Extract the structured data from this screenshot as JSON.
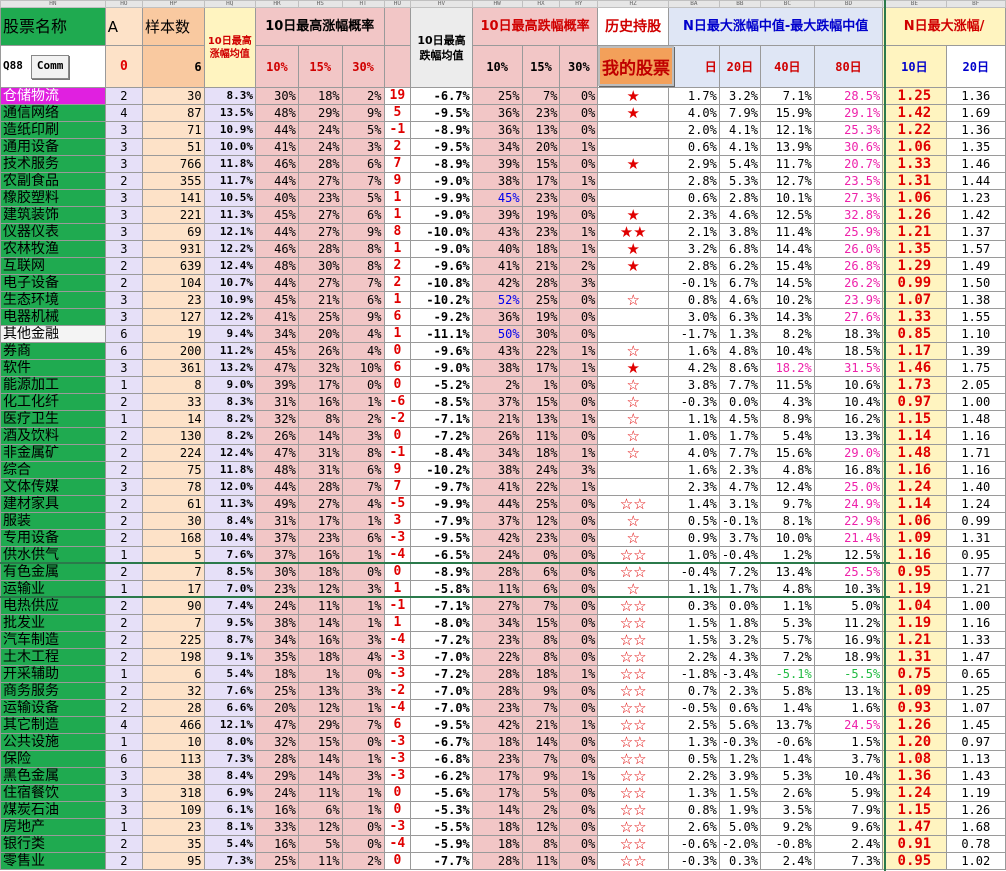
{
  "colors": {
    "green": "#1faa50",
    "pink": "#f2c6c6",
    "blue_head": "#dfe6f5",
    "orange": "#f9c9a0",
    "yellow": "#fff4c0",
    "red": "#e00000",
    "lav": "#e6e0f8",
    "peach": "#fde2c8"
  },
  "col_letters": [
    "HN",
    "HO",
    "HP",
    "HQ",
    "HR",
    "HS",
    "HT",
    "HU",
    "HV",
    "HW",
    "HX",
    "HY",
    "HZ",
    "BA",
    "BB",
    "BC",
    "BD",
    "BE",
    "BF"
  ],
  "header1": {
    "name": "股票名称",
    "a": "A",
    "count": "样本数",
    "avg10": "10日最高涨幅均值",
    "up10": "10日最高涨幅概率",
    "down_avg": "10日最高跌幅均值",
    "down10": "10日最高跌幅概率",
    "history": "历史持股",
    "median": "N日最大涨幅中值-最大跌幅中值",
    "nmax": "N日最大涨幅/"
  },
  "header2": {
    "code": "Q88",
    "comm": "Comm",
    "a_val": "0",
    "count_val": "6",
    "p10": "10%",
    "p15": "15%",
    "p30": "30%",
    "d10": "10%",
    "d15": "15%",
    "d30": "30%",
    "day": "日",
    "d20": "20日",
    "d40": "40日",
    "d80": "80日",
    "n10": "10日",
    "n20": "20日"
  },
  "my_stock_button": "我的股票",
  "rows": [
    {
      "name": "仓储物流",
      "a": "2",
      "n": "30",
      "avg": "8.3%",
      "u10": "30%",
      "u15": "18%",
      "u30": "2%",
      "hu": "19",
      "hv": "-6.7%",
      "w10": "25%",
      "w15": "7%",
      "w30": "0%",
      "star": "★",
      "ba": "1.7%",
      "bb": "3.2%",
      "bc": "7.1%",
      "bd": "28.5%",
      "be": "1.25",
      "bf": "1.36",
      "nameBg": "#e020e0",
      "nameColor": "#ffffff",
      "bdRed": true
    },
    {
      "name": "通信网络",
      "a": "4",
      "n": "87",
      "avg": "13.5%",
      "u10": "48%",
      "u15": "29%",
      "u30": "9%",
      "hu": "5",
      "hv": "-9.5%",
      "w10": "36%",
      "w15": "23%",
      "w30": "0%",
      "star": "★",
      "ba": "4.0%",
      "bb": "7.9%",
      "bc": "15.9%",
      "bd": "29.1%",
      "be": "1.42",
      "bf": "1.69",
      "bdRed": true
    },
    {
      "name": "造纸印刷",
      "a": "3",
      "n": "71",
      "avg": "10.9%",
      "u10": "44%",
      "u15": "24%",
      "u30": "5%",
      "hu": "-1",
      "hv": "-8.9%",
      "w10": "36%",
      "w15": "13%",
      "w30": "0%",
      "star": "",
      "ba": "2.0%",
      "bb": "4.1%",
      "bc": "12.1%",
      "bd": "25.3%",
      "be": "1.22",
      "bf": "1.36",
      "bdRed": true
    },
    {
      "name": "通用设备",
      "a": "3",
      "n": "51",
      "avg": "10.0%",
      "u10": "41%",
      "u15": "24%",
      "u30": "3%",
      "hu": "2",
      "hv": "-9.5%",
      "w10": "34%",
      "w15": "20%",
      "w30": "1%",
      "star": "",
      "ba": "0.6%",
      "bb": "4.1%",
      "bc": "13.9%",
      "bd": "30.6%",
      "be": "1.06",
      "bf": "1.35",
      "bdRed": true
    },
    {
      "name": "技术服务",
      "a": "3",
      "n": "766",
      "avg": "11.8%",
      "u10": "46%",
      "u15": "28%",
      "u30": "6%",
      "hu": "7",
      "hv": "-8.9%",
      "w10": "39%",
      "w15": "15%",
      "w30": "0%",
      "star": "★",
      "ba": "2.9%",
      "bb": "5.4%",
      "bc": "11.7%",
      "bd": "20.7%",
      "be": "1.33",
      "bf": "1.46",
      "bdRed": true
    },
    {
      "name": "农副食品",
      "a": "2",
      "n": "355",
      "avg": "11.7%",
      "u10": "44%",
      "u15": "27%",
      "u30": "7%",
      "hu": "9",
      "hv": "-9.0%",
      "w10": "38%",
      "w15": "17%",
      "w30": "1%",
      "star": "",
      "ba": "2.8%",
      "bb": "5.3%",
      "bc": "12.7%",
      "bd": "23.5%",
      "be": "1.31",
      "bf": "1.44",
      "bdRed": true
    },
    {
      "name": "橡胶塑料",
      "a": "3",
      "n": "141",
      "avg": "10.5%",
      "u10": "40%",
      "u15": "23%",
      "u30": "5%",
      "hu": "1",
      "hv": "-9.9%",
      "w10": "45%",
      "w15": "23%",
      "w30": "0%",
      "star": "",
      "ba": "0.6%",
      "bb": "2.8%",
      "bc": "10.1%",
      "bd": "27.3%",
      "be": "1.06",
      "bf": "1.23",
      "bdRed": true,
      "w10Blue": true
    },
    {
      "name": "建筑装饰",
      "a": "3",
      "n": "221",
      "avg": "11.3%",
      "u10": "45%",
      "u15": "27%",
      "u30": "6%",
      "hu": "1",
      "hv": "-9.0%",
      "w10": "39%",
      "w15": "19%",
      "w30": "0%",
      "star": "★",
      "ba": "2.3%",
      "bb": "4.6%",
      "bc": "12.5%",
      "bd": "32.8%",
      "be": "1.26",
      "bf": "1.42",
      "bdRed": true
    },
    {
      "name": "仪器仪表",
      "a": "3",
      "n": "69",
      "avg": "12.1%",
      "u10": "44%",
      "u15": "27%",
      "u30": "9%",
      "hu": "8",
      "hv": "-10.0%",
      "w10": "43%",
      "w15": "23%",
      "w30": "1%",
      "star": "★★",
      "ba": "2.1%",
      "bb": "3.8%",
      "bc": "11.4%",
      "bd": "25.9%",
      "be": "1.21",
      "bf": "1.37",
      "bdRed": true
    },
    {
      "name": "农林牧渔",
      "a": "3",
      "n": "931",
      "avg": "12.2%",
      "u10": "46%",
      "u15": "28%",
      "u30": "8%",
      "hu": "1",
      "hv": "-9.0%",
      "w10": "40%",
      "w15": "18%",
      "w30": "1%",
      "star": "★",
      "ba": "3.2%",
      "bb": "6.8%",
      "bc": "14.4%",
      "bd": "26.0%",
      "be": "1.35",
      "bf": "1.57",
      "bdRed": true
    },
    {
      "name": "互联网",
      "a": "2",
      "n": "639",
      "avg": "12.4%",
      "u10": "48%",
      "u15": "30%",
      "u30": "8%",
      "hu": "2",
      "hv": "-9.6%",
      "w10": "41%",
      "w15": "21%",
      "w30": "2%",
      "star": "★",
      "ba": "2.8%",
      "bb": "6.2%",
      "bc": "15.4%",
      "bd": "26.8%",
      "be": "1.29",
      "bf": "1.49",
      "bdRed": true
    },
    {
      "name": "电子设备",
      "a": "2",
      "n": "104",
      "avg": "10.7%",
      "u10": "44%",
      "u15": "27%",
      "u30": "7%",
      "hu": "2",
      "hv": "-10.8%",
      "w10": "42%",
      "w15": "28%",
      "w30": "3%",
      "star": "",
      "ba": "-0.1%",
      "bb": "6.7%",
      "bc": "14.5%",
      "bd": "26.2%",
      "be": "0.99",
      "bf": "1.50",
      "bdRed": true
    },
    {
      "name": "生态环境",
      "a": "3",
      "n": "23",
      "avg": "10.9%",
      "u10": "45%",
      "u15": "21%",
      "u30": "6%",
      "hu": "1",
      "hv": "-10.2%",
      "w10": "52%",
      "w15": "25%",
      "w30": "0%",
      "star": "☆",
      "ba": "0.8%",
      "bb": "4.6%",
      "bc": "10.2%",
      "bd": "23.9%",
      "be": "1.07",
      "bf": "1.38",
      "bdRed": true,
      "w10Blue": true
    },
    {
      "name": "电器机械",
      "a": "3",
      "n": "127",
      "avg": "12.2%",
      "u10": "41%",
      "u15": "25%",
      "u30": "9%",
      "hu": "6",
      "hv": "-9.2%",
      "w10": "36%",
      "w15": "19%",
      "w30": "0%",
      "star": "",
      "ba": "3.0%",
      "bb": "6.3%",
      "bc": "14.3%",
      "bd": "27.6%",
      "be": "1.33",
      "bf": "1.55",
      "bdRed": true
    },
    {
      "name": "其他金融",
      "a": "6",
      "n": "19",
      "avg": "9.4%",
      "u10": "34%",
      "u15": "20%",
      "u30": "4%",
      "hu": "1",
      "hv": "-11.1%",
      "w10": "50%",
      "w15": "30%",
      "w30": "0%",
      "star": "",
      "ba": "-1.7%",
      "bb": "1.3%",
      "bc": "8.2%",
      "bd": "18.3%",
      "be": "0.85",
      "bf": "1.10",
      "nameBg": "#f4f4f4",
      "w10Blue": true
    },
    {
      "name": "券商",
      "a": "6",
      "n": "200",
      "avg": "11.2%",
      "u10": "45%",
      "u15": "26%",
      "u30": "4%",
      "hu": "0",
      "hv": "-9.6%",
      "w10": "43%",
      "w15": "22%",
      "w30": "1%",
      "star": "☆",
      "ba": "1.6%",
      "bb": "4.8%",
      "bc": "10.4%",
      "bd": "18.5%",
      "be": "1.17",
      "bf": "1.39"
    },
    {
      "name": "软件",
      "a": "3",
      "n": "361",
      "avg": "13.2%",
      "u10": "47%",
      "u15": "32%",
      "u30": "10%",
      "hu": "6",
      "hv": "-9.0%",
      "w10": "38%",
      "w15": "17%",
      "w30": "1%",
      "star": "★",
      "ba": "4.2%",
      "bb": "8.6%",
      "bc": "18.2%",
      "bd": "31.5%",
      "be": "1.46",
      "bf": "1.75",
      "bdRed": true,
      "bcRed": true
    },
    {
      "name": "能源加工",
      "a": "1",
      "n": "8",
      "avg": "9.0%",
      "u10": "39%",
      "u15": "17%",
      "u30": "0%",
      "hu": "0",
      "hv": "-5.2%",
      "w10": "2%",
      "w15": "1%",
      "w30": "0%",
      "star": "☆",
      "ba": "3.8%",
      "bb": "7.7%",
      "bc": "11.5%",
      "bd": "10.6%",
      "be": "1.73",
      "bf": "2.05"
    },
    {
      "name": "化工化纤",
      "a": "2",
      "n": "33",
      "avg": "8.3%",
      "u10": "31%",
      "u15": "16%",
      "u30": "1%",
      "hu": "-6",
      "hv": "-8.5%",
      "w10": "37%",
      "w15": "15%",
      "w30": "0%",
      "star": "☆",
      "ba": "-0.3%",
      "bb": "0.0%",
      "bc": "4.3%",
      "bd": "10.4%",
      "be": "0.97",
      "bf": "1.00"
    },
    {
      "name": "医疗卫生",
      "a": "1",
      "n": "14",
      "avg": "8.2%",
      "u10": "32%",
      "u15": "8%",
      "u30": "2%",
      "hu": "-2",
      "hv": "-7.1%",
      "w10": "21%",
      "w15": "13%",
      "w30": "1%",
      "star": "☆",
      "ba": "1.1%",
      "bb": "4.5%",
      "bc": "8.9%",
      "bd": "16.2%",
      "be": "1.15",
      "bf": "1.48"
    },
    {
      "name": "酒及饮料",
      "a": "2",
      "n": "130",
      "avg": "8.2%",
      "u10": "26%",
      "u15": "14%",
      "u30": "3%",
      "hu": "0",
      "hv": "-7.2%",
      "w10": "26%",
      "w15": "11%",
      "w30": "0%",
      "star": "☆",
      "ba": "1.0%",
      "bb": "1.7%",
      "bc": "5.4%",
      "bd": "13.3%",
      "be": "1.14",
      "bf": "1.16"
    },
    {
      "name": "非金属矿",
      "a": "2",
      "n": "224",
      "avg": "12.4%",
      "u10": "47%",
      "u15": "31%",
      "u30": "8%",
      "hu": "-1",
      "hv": "-8.4%",
      "w10": "34%",
      "w15": "18%",
      "w30": "1%",
      "star": "☆",
      "ba": "4.0%",
      "bb": "7.7%",
      "bc": "15.6%",
      "bd": "29.0%",
      "be": "1.48",
      "bf": "1.71",
      "bdRed": true
    },
    {
      "name": "综合",
      "a": "2",
      "n": "75",
      "avg": "11.8%",
      "u10": "48%",
      "u15": "31%",
      "u30": "6%",
      "hu": "9",
      "hv": "-10.2%",
      "w10": "38%",
      "w15": "24%",
      "w30": "3%",
      "star": "",
      "ba": "1.6%",
      "bb": "2.3%",
      "bc": "4.8%",
      "bd": "16.8%",
      "be": "1.16",
      "bf": "1.16"
    },
    {
      "name": "文体传媒",
      "a": "3",
      "n": "78",
      "avg": "12.0%",
      "u10": "44%",
      "u15": "28%",
      "u30": "7%",
      "hu": "7",
      "hv": "-9.7%",
      "w10": "41%",
      "w15": "22%",
      "w30": "1%",
      "star": "",
      "ba": "2.3%",
      "bb": "4.7%",
      "bc": "12.4%",
      "bd": "25.0%",
      "be": "1.24",
      "bf": "1.40",
      "bdRed": true
    },
    {
      "name": "建材家具",
      "a": "2",
      "n": "61",
      "avg": "11.3%",
      "u10": "49%",
      "u15": "27%",
      "u30": "4%",
      "hu": "-5",
      "hv": "-9.9%",
      "w10": "44%",
      "w15": "25%",
      "w30": "0%",
      "star": "☆☆",
      "ba": "1.4%",
      "bb": "3.1%",
      "bc": "9.7%",
      "bd": "24.9%",
      "be": "1.14",
      "bf": "1.24",
      "bdRed": true
    },
    {
      "name": "服装",
      "a": "2",
      "n": "30",
      "avg": "8.4%",
      "u10": "31%",
      "u15": "17%",
      "u30": "1%",
      "hu": "3",
      "hv": "-7.9%",
      "w10": "37%",
      "w15": "12%",
      "w30": "0%",
      "star": "☆",
      "ba": "0.5%",
      "bb": "-0.1%",
      "bc": "8.1%",
      "bd": "22.9%",
      "be": "1.06",
      "bf": "0.99",
      "bdRed": true
    },
    {
      "name": "专用设备",
      "a": "2",
      "n": "168",
      "avg": "10.4%",
      "u10": "37%",
      "u15": "23%",
      "u30": "6%",
      "hu": "-3",
      "hv": "-9.5%",
      "w10": "42%",
      "w15": "23%",
      "w30": "0%",
      "star": "☆",
      "ba": "0.9%",
      "bb": "3.7%",
      "bc": "10.0%",
      "bd": "21.4%",
      "be": "1.09",
      "bf": "1.31",
      "bdRed": true
    },
    {
      "name": "供水供气",
      "a": "1",
      "n": "5",
      "avg": "7.6%",
      "u10": "37%",
      "u15": "16%",
      "u30": "1%",
      "hu": "-4",
      "hv": "-6.5%",
      "w10": "24%",
      "w15": "0%",
      "w30": "0%",
      "star": "☆☆",
      "ba": "1.0%",
      "bb": "-0.4%",
      "bc": "1.2%",
      "bd": "12.5%",
      "be": "1.16",
      "bf": "0.95"
    },
    {
      "name": "有色金属",
      "a": "2",
      "n": "7",
      "avg": "8.5%",
      "u10": "30%",
      "u15": "18%",
      "u30": "0%",
      "hu": "0",
      "hv": "-8.9%",
      "w10": "28%",
      "w15": "6%",
      "w30": "0%",
      "star": "☆☆",
      "ba": "-0.4%",
      "bb": "7.2%",
      "bc": "13.4%",
      "bd": "25.5%",
      "be": "0.95",
      "bf": "1.77",
      "bdRed": true,
      "sel": true
    },
    {
      "name": "运输业",
      "a": "1",
      "n": "17",
      "avg": "7.0%",
      "u10": "23%",
      "u15": "12%",
      "u30": "3%",
      "hu": "1",
      "hv": "-5.8%",
      "w10": "11%",
      "w15": "6%",
      "w30": "0%",
      "star": "☆",
      "ba": "1.1%",
      "bb": "1.7%",
      "bc": "4.8%",
      "bd": "10.3%",
      "be": "1.19",
      "bf": "1.21",
      "sel": true
    },
    {
      "name": "电热供应",
      "a": "2",
      "n": "90",
      "avg": "7.4%",
      "u10": "24%",
      "u15": "11%",
      "u30": "1%",
      "hu": "-1",
      "hv": "-7.1%",
      "w10": "27%",
      "w15": "7%",
      "w30": "0%",
      "star": "☆☆",
      "ba": "0.3%",
      "bb": "0.0%",
      "bc": "1.1%",
      "bd": "5.0%",
      "be": "1.04",
      "bf": "1.00"
    },
    {
      "name": "批发业",
      "a": "2",
      "n": "7",
      "avg": "9.5%",
      "u10": "38%",
      "u15": "14%",
      "u30": "1%",
      "hu": "1",
      "hv": "-8.0%",
      "w10": "34%",
      "w15": "15%",
      "w30": "0%",
      "star": "☆☆",
      "ba": "1.5%",
      "bb": "1.8%",
      "bc": "5.3%",
      "bd": "11.2%",
      "be": "1.19",
      "bf": "1.16"
    },
    {
      "name": "汽车制造",
      "a": "2",
      "n": "225",
      "avg": "8.7%",
      "u10": "34%",
      "u15": "16%",
      "u30": "3%",
      "hu": "-4",
      "hv": "-7.2%",
      "w10": "23%",
      "w15": "8%",
      "w30": "0%",
      "star": "☆☆",
      "ba": "1.5%",
      "bb": "3.2%",
      "bc": "5.7%",
      "bd": "16.9%",
      "be": "1.21",
      "bf": "1.33"
    },
    {
      "name": "土木工程",
      "a": "2",
      "n": "198",
      "avg": "9.1%",
      "u10": "35%",
      "u15": "18%",
      "u30": "4%",
      "hu": "-3",
      "hv": "-7.0%",
      "w10": "22%",
      "w15": "8%",
      "w30": "0%",
      "star": "☆☆",
      "ba": "2.2%",
      "bb": "4.3%",
      "bc": "7.2%",
      "bd": "18.9%",
      "be": "1.31",
      "bf": "1.47"
    },
    {
      "name": "开采辅助",
      "a": "1",
      "n": "6",
      "avg": "5.4%",
      "u10": "18%",
      "u15": "1%",
      "u30": "0%",
      "hu": "-3",
      "hv": "-7.2%",
      "w10": "28%",
      "w15": "18%",
      "w30": "1%",
      "star": "☆☆",
      "ba": "-1.8%",
      "bb": "-3.4%",
      "bc": "-5.1%",
      "bd": "-5.5%",
      "be": "0.75",
      "bf": "0.65",
      "bcGreen": true,
      "bdGreen": true
    },
    {
      "name": "商务服务",
      "a": "2",
      "n": "32",
      "avg": "7.6%",
      "u10": "25%",
      "u15": "13%",
      "u30": "3%",
      "hu": "-2",
      "hv": "-7.0%",
      "w10": "28%",
      "w15": "9%",
      "w30": "0%",
      "star": "☆☆",
      "ba": "0.7%",
      "bb": "2.3%",
      "bc": "5.8%",
      "bd": "13.1%",
      "be": "1.09",
      "bf": "1.25"
    },
    {
      "name": "运输设备",
      "a": "2",
      "n": "28",
      "avg": "6.6%",
      "u10": "20%",
      "u15": "12%",
      "u30": "1%",
      "hu": "-4",
      "hv": "-7.0%",
      "w10": "23%",
      "w15": "7%",
      "w30": "0%",
      "star": "☆☆",
      "ba": "-0.5%",
      "bb": "0.6%",
      "bc": "1.4%",
      "bd": "1.6%",
      "be": "0.93",
      "bf": "1.07"
    },
    {
      "name": "其它制造",
      "a": "4",
      "n": "466",
      "avg": "12.1%",
      "u10": "47%",
      "u15": "29%",
      "u30": "7%",
      "hu": "6",
      "hv": "-9.5%",
      "w10": "42%",
      "w15": "21%",
      "w30": "1%",
      "star": "☆☆",
      "ba": "2.5%",
      "bb": "5.6%",
      "bc": "13.7%",
      "bd": "24.5%",
      "be": "1.26",
      "bf": "1.45",
      "bdRed": true
    },
    {
      "name": "公共设施",
      "a": "1",
      "n": "10",
      "avg": "8.0%",
      "u10": "32%",
      "u15": "15%",
      "u30": "0%",
      "hu": "-3",
      "hv": "-6.7%",
      "w10": "18%",
      "w15": "14%",
      "w30": "0%",
      "star": "☆☆",
      "ba": "1.3%",
      "bb": "-0.3%",
      "bc": "-0.6%",
      "bd": "1.5%",
      "be": "1.20",
      "bf": "0.97"
    },
    {
      "name": "保险",
      "a": "6",
      "n": "113",
      "avg": "7.3%",
      "u10": "28%",
      "u15": "14%",
      "u30": "1%",
      "hu": "-3",
      "hv": "-6.8%",
      "w10": "23%",
      "w15": "7%",
      "w30": "0%",
      "star": "☆☆",
      "ba": "0.5%",
      "bb": "1.2%",
      "bc": "1.4%",
      "bd": "3.7%",
      "be": "1.08",
      "bf": "1.13"
    },
    {
      "name": "黑色金属",
      "a": "3",
      "n": "38",
      "avg": "8.4%",
      "u10": "29%",
      "u15": "14%",
      "u30": "3%",
      "hu": "-3",
      "hv": "-6.2%",
      "w10": "17%",
      "w15": "9%",
      "w30": "1%",
      "star": "☆☆",
      "ba": "2.2%",
      "bb": "3.9%",
      "bc": "5.3%",
      "bd": "10.4%",
      "be": "1.36",
      "bf": "1.43"
    },
    {
      "name": "住宿餐饮",
      "a": "3",
      "n": "318",
      "avg": "6.9%",
      "u10": "24%",
      "u15": "11%",
      "u30": "1%",
      "hu": "0",
      "hv": "-5.6%",
      "w10": "17%",
      "w15": "5%",
      "w30": "0%",
      "star": "☆☆",
      "ba": "1.3%",
      "bb": "1.5%",
      "bc": "2.6%",
      "bd": "5.9%",
      "be": "1.24",
      "bf": "1.19"
    },
    {
      "name": "煤炭石油",
      "a": "3",
      "n": "109",
      "avg": "6.1%",
      "u10": "16%",
      "u15": "6%",
      "u30": "1%",
      "hu": "0",
      "hv": "-5.3%",
      "w10": "14%",
      "w15": "2%",
      "w30": "0%",
      "star": "☆☆",
      "ba": "0.8%",
      "bb": "1.9%",
      "bc": "3.5%",
      "bd": "7.9%",
      "be": "1.15",
      "bf": "1.26"
    },
    {
      "name": "房地产",
      "a": "1",
      "n": "23",
      "avg": "8.1%",
      "u10": "33%",
      "u15": "12%",
      "u30": "0%",
      "hu": "-3",
      "hv": "-5.5%",
      "w10": "18%",
      "w15": "12%",
      "w30": "0%",
      "star": "☆☆",
      "ba": "2.6%",
      "bb": "5.0%",
      "bc": "9.2%",
      "bd": "9.6%",
      "be": "1.47",
      "bf": "1.68"
    },
    {
      "name": "银行类",
      "a": "2",
      "n": "35",
      "avg": "5.4%",
      "u10": "16%",
      "u15": "5%",
      "u30": "0%",
      "hu": "-4",
      "hv": "-5.9%",
      "w10": "18%",
      "w15": "8%",
      "w30": "0%",
      "star": "☆☆",
      "ba": "-0.6%",
      "bb": "-2.0%",
      "bc": "-0.8%",
      "bd": "2.4%",
      "be": "0.91",
      "bf": "0.78"
    },
    {
      "name": "零售业",
      "a": "2",
      "n": "95",
      "avg": "7.3%",
      "u10": "25%",
      "u15": "11%",
      "u30": "2%",
      "hu": "0",
      "hv": "-7.7%",
      "w10": "28%",
      "w15": "11%",
      "w30": "0%",
      "star": "☆☆",
      "ba": "-0.3%",
      "bb": "0.3%",
      "bc": "2.4%",
      "bd": "7.3%",
      "be": "0.95",
      "bf": "1.02"
    }
  ]
}
